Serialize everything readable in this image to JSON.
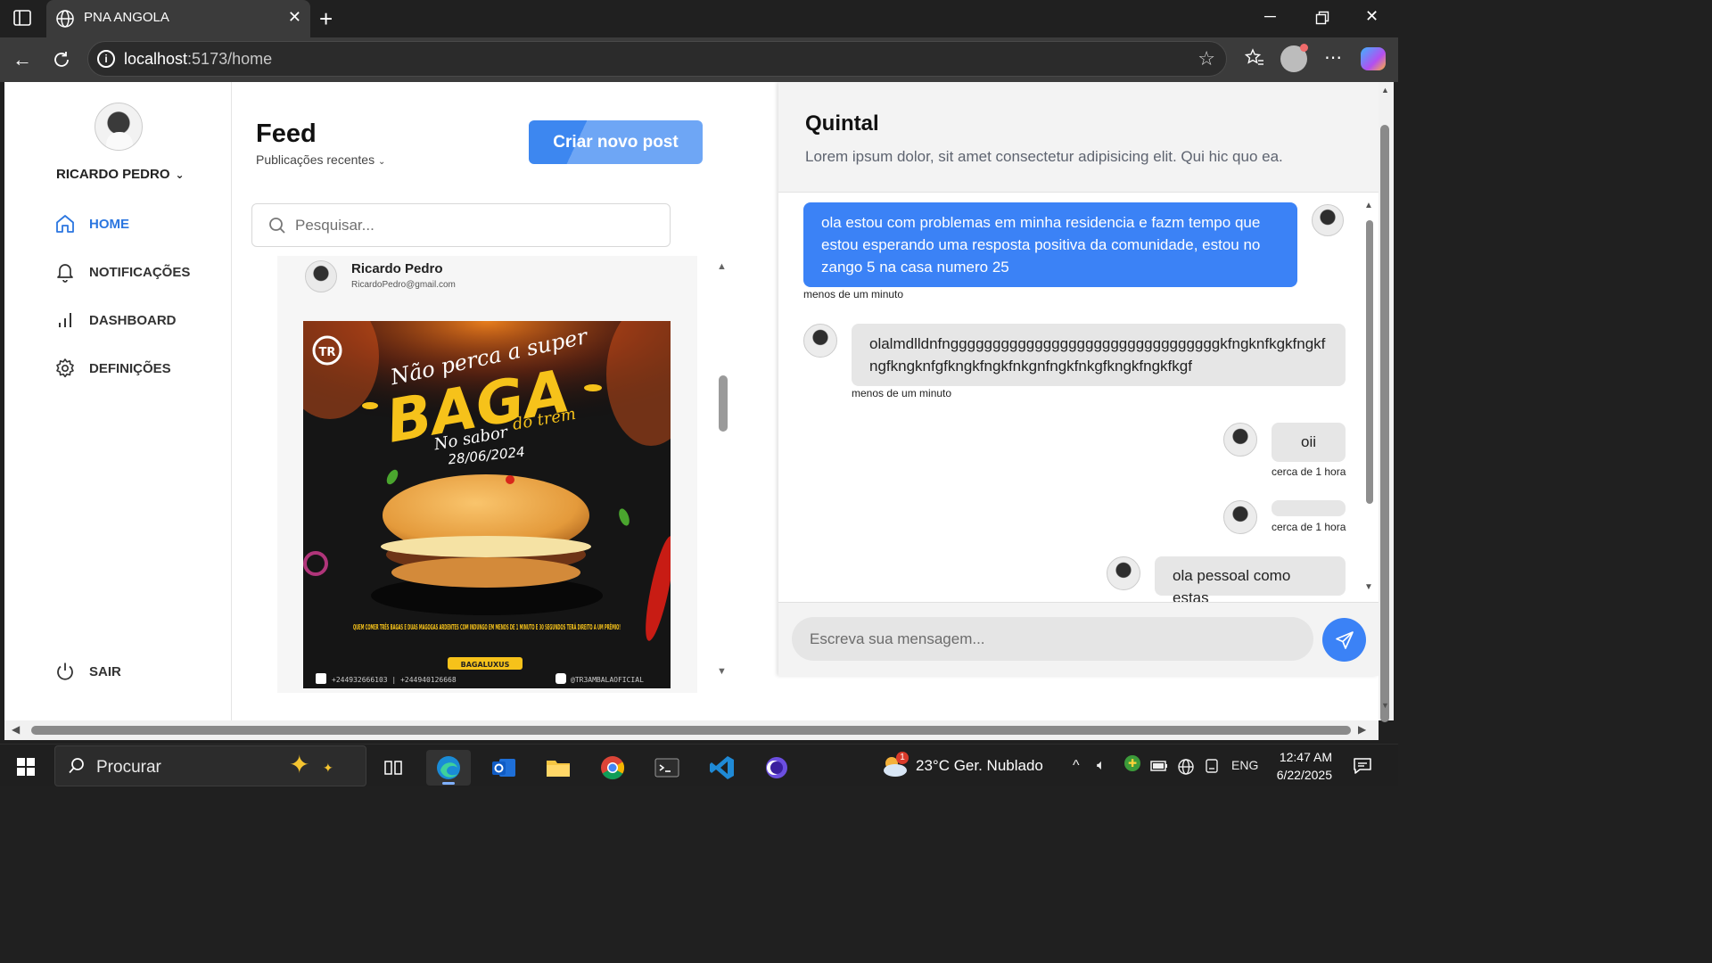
{
  "browser": {
    "tab_title": "PNA ANGOLA",
    "url_host": "localhost",
    "url_path": ":5173/home"
  },
  "sidebar": {
    "username": "RICARDO PEDRO",
    "items": [
      {
        "label": "HOME",
        "icon": "home-icon",
        "active": true
      },
      {
        "label": "NOTIFICAÇÕES",
        "icon": "bell-icon",
        "active": false
      },
      {
        "label": "DASHBOARD",
        "icon": "bar-chart-icon",
        "active": false
      },
      {
        "label": "DEFINIÇÕES",
        "icon": "gear-icon",
        "active": false
      }
    ],
    "logout_label": "SAIR"
  },
  "feed": {
    "title": "Feed",
    "subtitle": "Publicações recentes",
    "new_post_label": "Criar novo post",
    "search_placeholder": "Pesquisar...",
    "post": {
      "author": "Ricardo Pedro",
      "email": "RicardoPedro@gmail.com",
      "image": {
        "line1": "Não perca a super",
        "line2": "BAGA",
        "line3_a": "No sabor",
        "line3_b": "do trem",
        "date": "28/06/2024",
        "footer": "QUEM COMER TRÊS BAGAS E DUAS MAGOGAS ARDENTES COM INDUNGO EM MENOS DE 1 MINUTO E 30 SEGUNDOS TERÁ DIREITO A UM PRÊMIO!",
        "badge": "BAGALUXUS",
        "phone": "+244932666103 | +244940126668",
        "social": "@TR3AMBALAOFICIAL"
      }
    }
  },
  "chat": {
    "title": "Quintal",
    "description": "Lorem ipsum dolor, sit amet consectetur adipisicing elit. Qui hic quo ea.",
    "messages": [
      {
        "text": "ola estou com problemas em minha residencia e fazm tempo que estou esperando uma resposta positiva da comunidade, estou no zango 5 na casa numero 25",
        "time": "menos de um minuto"
      },
      {
        "text": "olalmdlldnfnggggggggggggggggggggggggggggggggkfngknfkgkfngkfngfkngknfgfkngkfngkfnkgnfngkfnkgfkngkfngkfkgf",
        "time": "menos de um minuto"
      },
      {
        "text": "oii",
        "time": "cerca de 1 hora"
      },
      {
        "text": "",
        "time": "cerca de 1 hora"
      },
      {
        "text": "ola pessoal como estas",
        "time": ""
      }
    ],
    "input_placeholder": "Escreva sua mensagem..."
  },
  "taskbar": {
    "search_label": "Procurar",
    "weather": "23°C  Ger. Nublado",
    "weather_badge": "1",
    "lang": "ENG",
    "time": "12:47 AM",
    "date": "6/22/2025"
  }
}
